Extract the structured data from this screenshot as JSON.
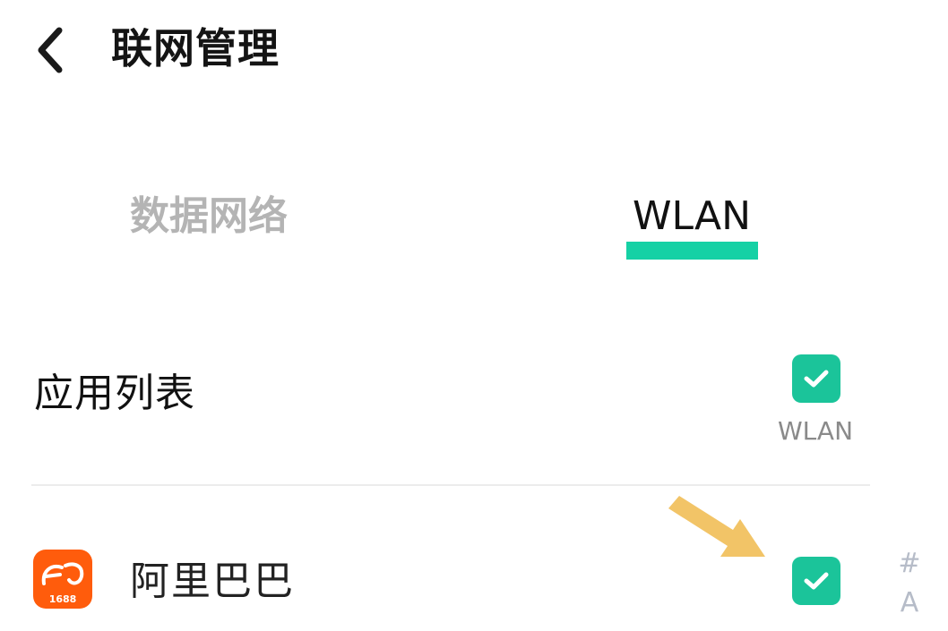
{
  "header": {
    "title": "联网管理",
    "back_icon": "chevron-left-icon"
  },
  "tabs": [
    {
      "label": "数据网络",
      "active": false
    },
    {
      "label": "WLAN",
      "active": true
    }
  ],
  "colors": {
    "accent": "#15d1a5",
    "checkbox": "#1bc49a",
    "arrow": "#f2c467",
    "app_icon": "#ff5c0c"
  },
  "list_header": {
    "label": "应用列表",
    "column_label": "WLAN",
    "all_checked": true
  },
  "apps": [
    {
      "name": "阿里巴巴",
      "icon_text": "1688",
      "icon": "alibaba-app-icon",
      "wlan_checked": true
    }
  ],
  "index_bar": [
    "#",
    "A"
  ]
}
